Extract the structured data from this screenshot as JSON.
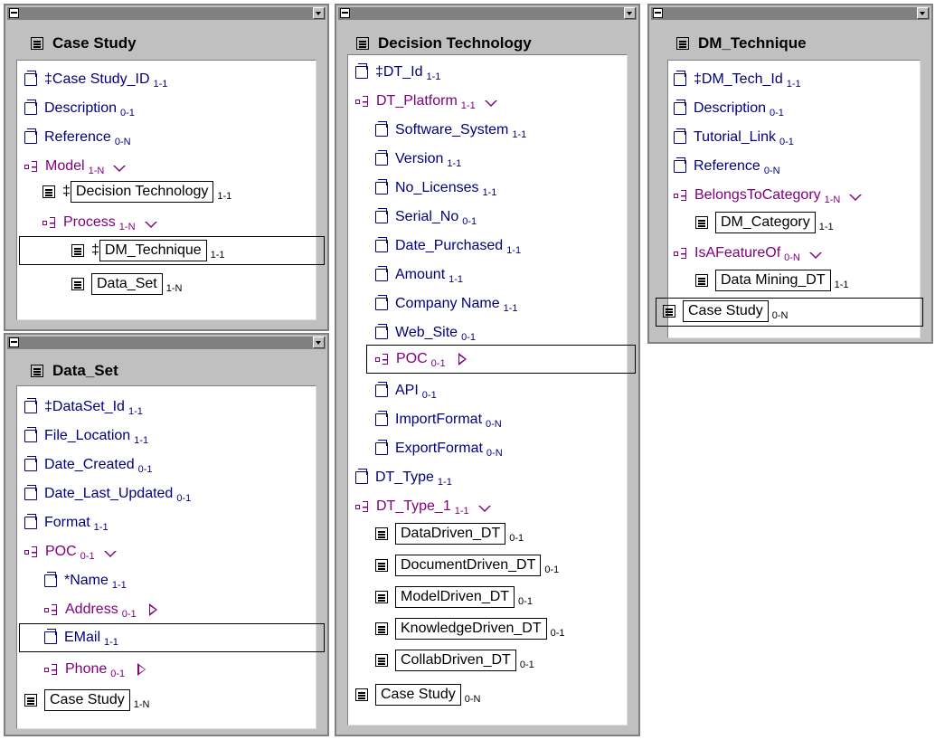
{
  "windows": {
    "case_study": {
      "title": "Case Study",
      "items": [
        {
          "label": "‡Case Study_ID",
          "card": "1-1"
        },
        {
          "label": "Description",
          "card": "0-1"
        },
        {
          "label": "Reference",
          "card": "0-N"
        },
        {
          "label": "Model",
          "card": "1-N"
        },
        {
          "prefix": "‡",
          "label": "Decision Technology",
          "card": "1-1"
        },
        {
          "label": "Process",
          "card": "1-N"
        },
        {
          "prefix": "‡",
          "label": "DM_Technique",
          "card": "1-1"
        },
        {
          "label": "Data_Set",
          "card": "1-N"
        }
      ]
    },
    "data_set": {
      "title": "Data_Set",
      "items": [
        {
          "label": "‡DataSet_Id",
          "card": "1-1"
        },
        {
          "label": "File_Location",
          "card": "1-1"
        },
        {
          "label": "Date_Created",
          "card": "0-1"
        },
        {
          "label": "Date_Last_Updated",
          "card": "0-1"
        },
        {
          "label": "Format",
          "card": "1-1"
        },
        {
          "label": "POC",
          "card": "0-1"
        },
        {
          "label": "*Name",
          "card": "1-1"
        },
        {
          "label": "Address",
          "card": "0-1"
        },
        {
          "label": "EMail",
          "card": "1-1"
        },
        {
          "label": "Phone",
          "card": "0-1"
        },
        {
          "label": "Case Study",
          "card": "1-N"
        }
      ]
    },
    "decision_technology": {
      "title": "Decision Technology",
      "items": [
        {
          "label": "‡DT_Id",
          "card": "1-1"
        },
        {
          "label": "DT_Platform",
          "card": "1-1"
        },
        {
          "label": "Software_System",
          "card": "1-1"
        },
        {
          "label": "Version",
          "card": "1-1"
        },
        {
          "label": "No_Licenses",
          "card": "1-1"
        },
        {
          "label": "Serial_No",
          "card": "0-1"
        },
        {
          "label": "Date_Purchased",
          "card": "1-1"
        },
        {
          "label": "Amount",
          "card": "1-1"
        },
        {
          "label": "Company Name",
          "card": "1-1"
        },
        {
          "label": "Web_Site",
          "card": "0-1"
        },
        {
          "label": "POC",
          "card": "0-1"
        },
        {
          "label": "API",
          "card": "0-1"
        },
        {
          "label": "ImportFormat",
          "card": "0-N"
        },
        {
          "label": "ExportFormat",
          "card": "0-N"
        },
        {
          "label": "DT_Type",
          "card": "1-1"
        },
        {
          "label": "DT_Type_1",
          "card": "1-1"
        },
        {
          "label": "DataDriven_DT",
          "card": "0-1"
        },
        {
          "label": "DocumentDriven_DT",
          "card": "0-1"
        },
        {
          "label": "ModelDriven_DT",
          "card": "0-1"
        },
        {
          "label": "KnowledgeDriven_DT",
          "card": "0-1"
        },
        {
          "label": "CollabDriven_DT",
          "card": "0-1"
        },
        {
          "label": "Case Study",
          "card": "0-N"
        }
      ]
    },
    "dm_technique": {
      "title": "DM_Technique",
      "items": [
        {
          "label": "‡DM_Tech_Id",
          "card": "1-1"
        },
        {
          "label": "Description",
          "card": "0-1"
        },
        {
          "label": "Tutorial_Link",
          "card": "0-1"
        },
        {
          "label": "Reference",
          "card": "0-N"
        },
        {
          "label": "BelongsToCategory",
          "card": "1-N"
        },
        {
          "label": "DM_Category",
          "card": "1-1"
        },
        {
          "label": "IsAFeatureOf",
          "card": "0-N"
        },
        {
          "label": "Data Mining_DT",
          "card": "1-1"
        },
        {
          "label": "Case Study",
          "card": "0-N"
        }
      ]
    }
  }
}
